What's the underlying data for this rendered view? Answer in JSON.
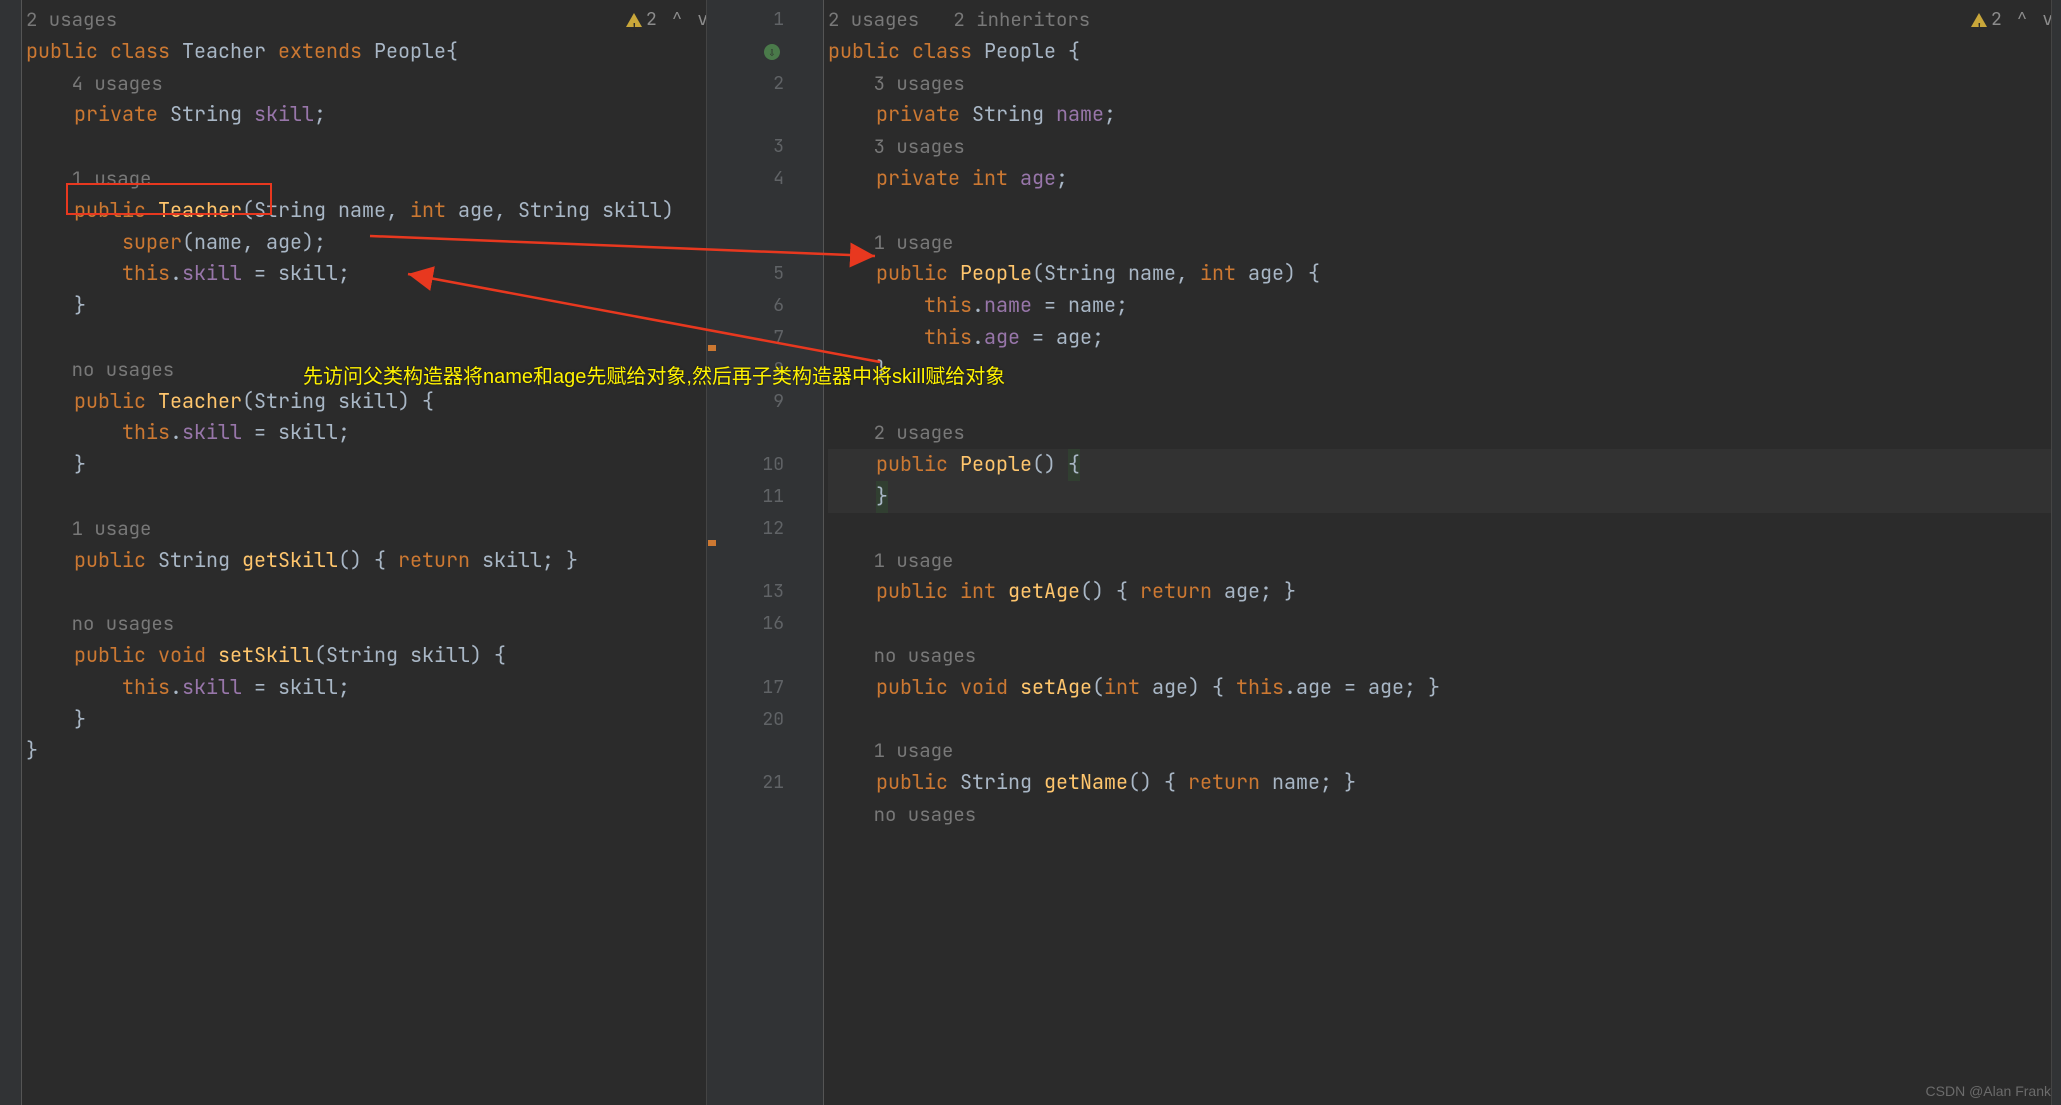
{
  "left": {
    "usages_class": "2 usages",
    "warning_count": "2",
    "class_decl": {
      "kw1": "public",
      "kw2": "class",
      "name": "Teacher",
      "kw3": "extends",
      "parent": "People",
      "brace": "{"
    },
    "field_usages": "4 usages",
    "field_decl": {
      "kw": "private",
      "type": "String",
      "name": "skill",
      "semi": ";"
    },
    "ctor1_usages": "1 usage",
    "ctor1_sig": {
      "kw": "public",
      "name": "Teacher",
      "params": "(String name, ",
      "kw_int": "int",
      "params2": " age, String skill)"
    },
    "ctor1_super": {
      "kw": "super",
      "args": "(name, age);"
    },
    "ctor1_assign": {
      "kw": "this",
      "dot": ".",
      "field": "skill",
      "eq": " = skill;"
    },
    "ctor2_usages": "no usages",
    "ctor2_sig": {
      "kw": "public",
      "name": "Teacher",
      "params": "(String skill) {"
    },
    "ctor2_assign": {
      "kw": "this",
      "dot": ".",
      "field": "skill",
      "eq": " = skill;"
    },
    "get_usages": "1 usage",
    "get_sig": {
      "kw": "public",
      "type": "String",
      "name": "getSkill",
      "body": "() { ",
      "kw_ret": "return",
      "ret": " skill; }"
    },
    "set_usages": "no usages",
    "set_sig": {
      "kw": "public",
      "kw_void": "void",
      "name": "setSkill",
      "params": "(String skill) {"
    },
    "set_assign": {
      "kw": "this",
      "dot": ".",
      "field": "skill",
      "eq": " = skill;"
    }
  },
  "right": {
    "usages_class": "2 usages",
    "inheritors": "2 inheritors",
    "warning_count": "2",
    "class_decl": {
      "kw1": "public",
      "kw2": "class",
      "name": "People",
      "brace": " {"
    },
    "name_usages": "3 usages",
    "name_decl": {
      "kw": "private",
      "type": "String",
      "name": "name",
      "semi": ";"
    },
    "age_usages": "3 usages",
    "age_decl": {
      "kw": "private",
      "kw_int": "int",
      "name": "age",
      "semi": ";"
    },
    "ctor1_usages": "1 usage",
    "ctor1_sig": {
      "kw": "public",
      "name": "People",
      "params": "(String name, ",
      "kw_int": "int",
      "params2": " age) {"
    },
    "ctor1_a1": {
      "kw": "this",
      "dot": ".",
      "field": "name",
      "eq": " = name;"
    },
    "ctor1_a2": {
      "kw": "this",
      "dot": ".",
      "field": "age",
      "eq": " = age;"
    },
    "ctor2_usages": "2 usages",
    "ctor2_sig": {
      "kw": "public",
      "name": "People",
      "body": "() ",
      "brace_open": "{"
    },
    "ctor2_close": "}",
    "getage_usages": "1 usage",
    "getage_sig": {
      "kw": "public",
      "kw_int": "int",
      "name": "getAge",
      "body": "() { ",
      "kw_ret": "return",
      "ret": " age; }"
    },
    "setage_usages": "no usages",
    "setage_sig": {
      "kw": "public",
      "kw_void": "void",
      "name": "setAge",
      "params": "(",
      "kw_int": "int",
      "params2": " age) { ",
      "kw_this": "this",
      "rest": ".age = age; }"
    },
    "getname_usages": "1 usage",
    "getname_sig": {
      "kw": "public",
      "type": "String",
      "name": "getName",
      "body": "() { ",
      "kw_ret": "return",
      "ret": " name; }"
    },
    "getname_trail": "no usages",
    "line_nums": [
      "1",
      "",
      "2",
      "",
      "3",
      "4",
      "",
      "",
      "5",
      "6",
      "7",
      "8",
      "9",
      "",
      "10",
      "11",
      "12",
      "",
      "13",
      "16",
      "",
      "17",
      "20",
      "",
      "21",
      ""
    ]
  },
  "annotation": "先访问父类构造器将name和age先赋给对象,然后再子类构造器中将skill赋给对象",
  "watermark": "CSDN @Alan Frank"
}
